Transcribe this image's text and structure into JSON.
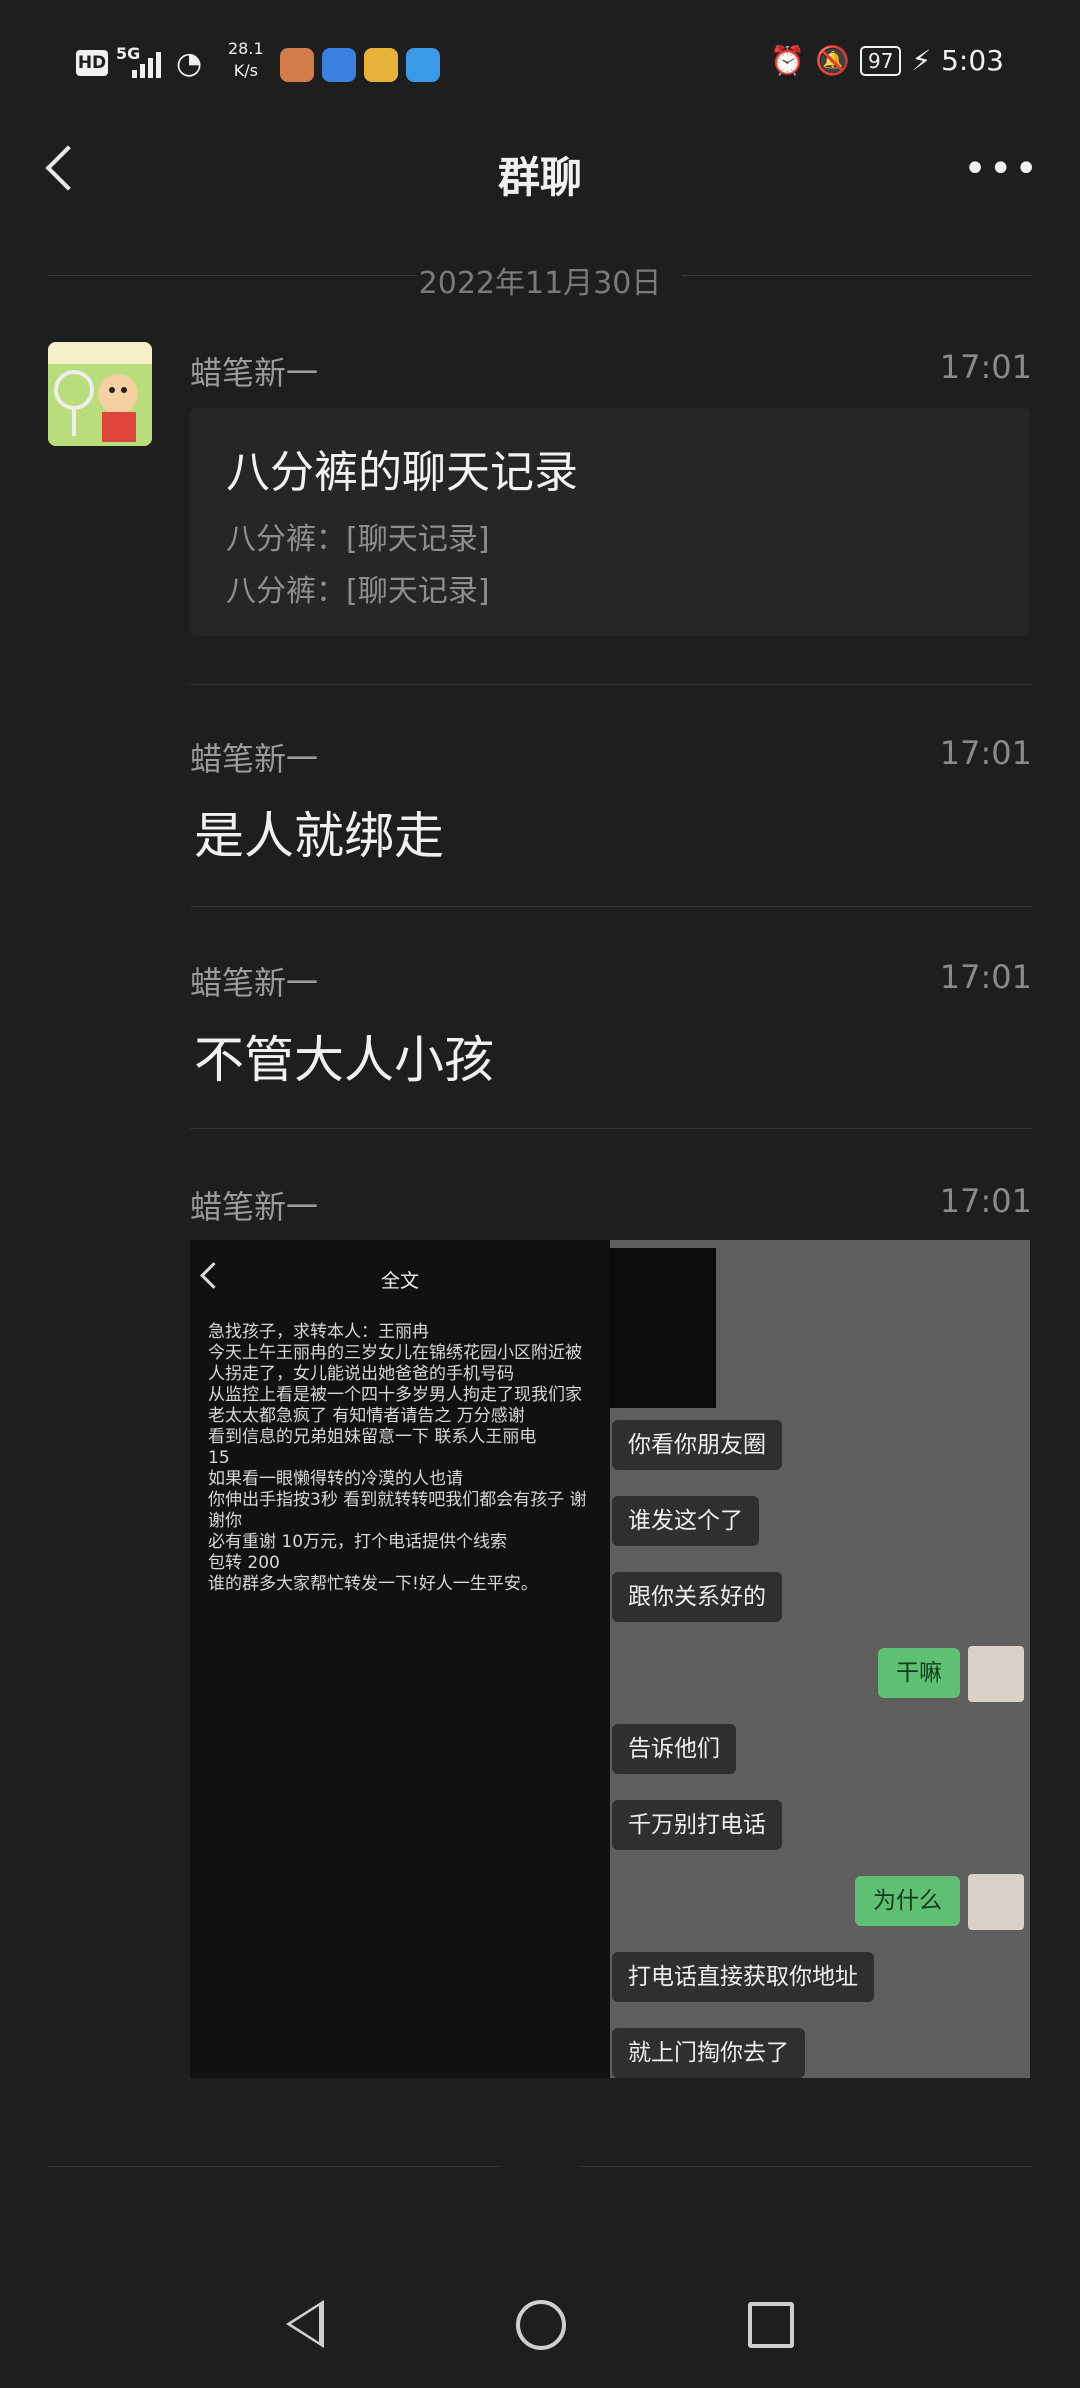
{
  "status_bar": {
    "hd": "HD",
    "network": "5G",
    "speed_value": "28.1",
    "speed_unit": "K/s",
    "battery": "97",
    "time": "5:03"
  },
  "header": {
    "title": "群聊"
  },
  "date_divider": "2022年11月30日",
  "messages": [
    {
      "sender": "蜡笔新一",
      "time": "17:01",
      "type": "chat_record",
      "record_title": "八分裤的聊天记录",
      "record_lines": [
        "八分裤：[聊天记录]",
        "八分裤：[聊天记录]"
      ]
    },
    {
      "sender": "蜡笔新一",
      "time": "17:01",
      "type": "text",
      "text": "是人就绑走"
    },
    {
      "sender": "蜡笔新一",
      "time": "17:01",
      "type": "text",
      "text": "不管大人小孩"
    },
    {
      "sender": "蜡笔新一",
      "time": "17:01",
      "type": "image",
      "image": {
        "left_title": "全文",
        "left_text": "急找孩子，求转本人：王丽冉\n今天上午王丽冉的三岁女儿在锦绣花园小区附近被人拐走了，女儿能说出她爸爸的手机号码\n从监控上看是被一个四十多岁男人拘走了现我们家老太太都急疯了 有知情者请告之 万分感谢\n看到信息的兄弟姐妹留意一下 联系人王丽电\n15\n如果看一眼懒得转的冷漠的人也请\n你伸出手指按3秒 看到就转转吧我们都会有孩子 谢谢你\n必有重谢 10万元，打个电话提供个线索\n包转 200\n谁的群多大家帮忙转发一下!好人一生平安。",
        "bubbles": [
          {
            "text": "你看你朋友圈",
            "side": "left"
          },
          {
            "text": "谁发这个了",
            "side": "left"
          },
          {
            "text": "跟你关系好的",
            "side": "left"
          },
          {
            "text": "干嘛",
            "side": "right"
          },
          {
            "text": "告诉他们",
            "side": "left"
          },
          {
            "text": "千万别打电话",
            "side": "left"
          },
          {
            "text": "为什么",
            "side": "right"
          },
          {
            "text": "打电话直接获取你地址",
            "side": "left"
          },
          {
            "text": "就上门掏你去了",
            "side": "left"
          }
        ]
      }
    }
  ]
}
